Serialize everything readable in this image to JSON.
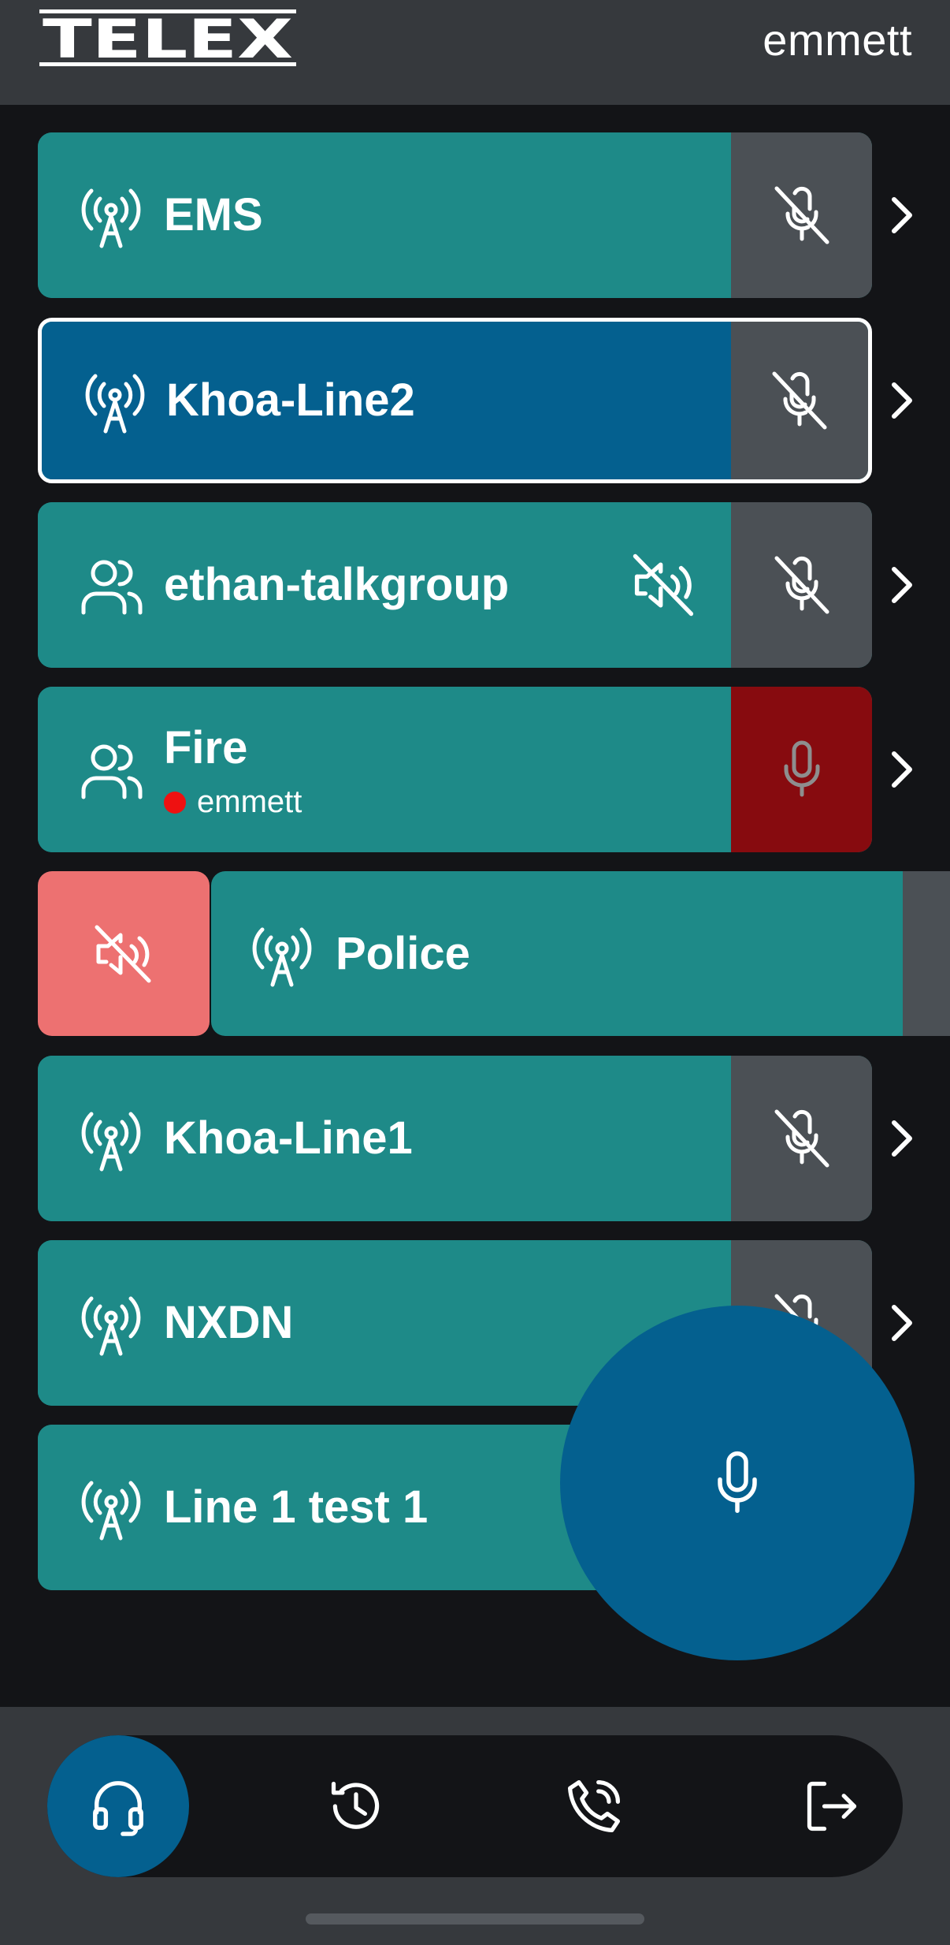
{
  "header": {
    "logo_text": "TELEX",
    "username": "emmett"
  },
  "channels": [
    {
      "label": "EMS",
      "type_icon": "radio-tower-icon",
      "ptt_icon": "mic-off-icon",
      "muted": false,
      "selected": false
    },
    {
      "label": "Khoa-Line2",
      "type_icon": "radio-tower-icon",
      "ptt_icon": "mic-off-icon",
      "muted": false,
      "selected": true
    },
    {
      "label": "ethan-talkgroup",
      "type_icon": "group-icon",
      "ptt_icon": "mic-off-icon",
      "muted": true,
      "selected": false
    },
    {
      "label": "Fire",
      "type_icon": "group-icon",
      "ptt_icon": "mic-icon",
      "talker": "emmett",
      "transmitting": true,
      "selected": false
    },
    {
      "label": "Police",
      "type_icon": "radio-tower-icon",
      "swiped": true,
      "swipe_action_icon": "speaker-mute-icon"
    },
    {
      "label": "Khoa-Line1",
      "type_icon": "radio-tower-icon",
      "ptt_icon": "mic-off-icon",
      "selected": false
    },
    {
      "label": "NXDN",
      "type_icon": "radio-tower-icon",
      "ptt_icon": "mic-off-icon",
      "selected": false
    },
    {
      "label": "Line 1 test 1",
      "type_icon": "radio-tower-icon",
      "selected": false
    }
  ],
  "fab": {
    "icon": "mic-icon"
  },
  "nav": [
    {
      "name": "headset",
      "icon": "headset-icon",
      "active": true
    },
    {
      "name": "history",
      "icon": "history-icon",
      "active": false
    },
    {
      "name": "calls",
      "icon": "phone-call-icon",
      "active": false
    },
    {
      "name": "logout",
      "icon": "logout-icon",
      "active": false
    }
  ],
  "colors": {
    "header_bg": "#36393d",
    "page_bg": "#131417",
    "channel_teal": "#1e8a88",
    "selected_blue": "#04608f",
    "ptt_gray": "#4b5055",
    "ptt_active_red": "#870b0f",
    "swipe_red": "#ed7171",
    "talker_dot": "#ee1111"
  }
}
